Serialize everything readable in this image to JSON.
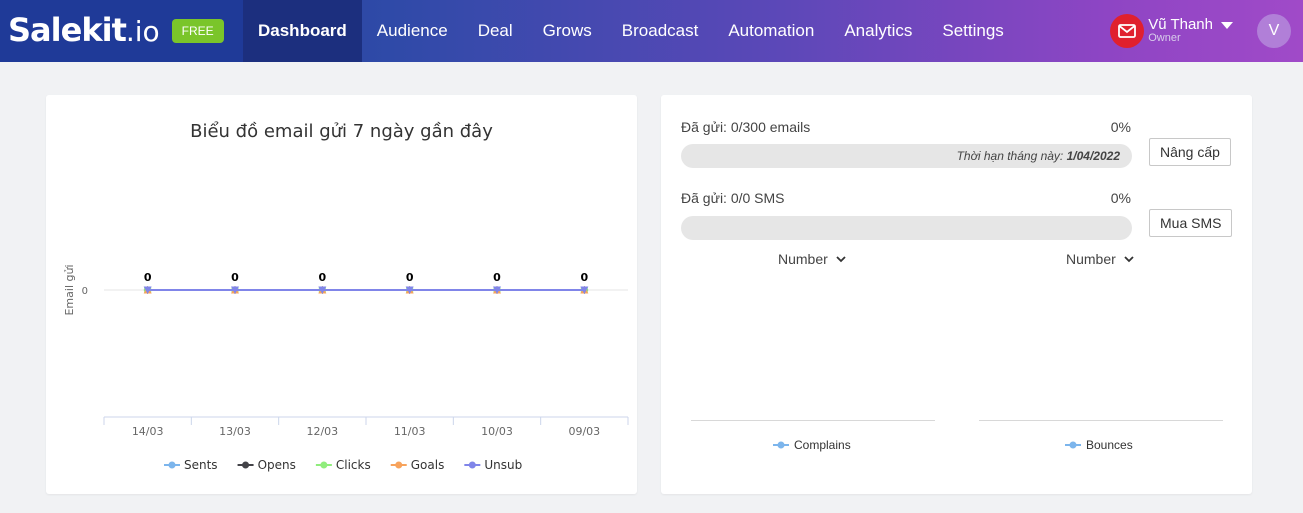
{
  "brand": {
    "logo_main": "Salekit",
    "logo_suffix": ".io",
    "plan_badge": "FREE"
  },
  "nav": {
    "items": [
      {
        "label": "Dashboard",
        "active": true
      },
      {
        "label": "Audience",
        "active": false
      },
      {
        "label": "Deal",
        "active": false
      },
      {
        "label": "Grows",
        "active": false
      },
      {
        "label": "Broadcast",
        "active": false
      },
      {
        "label": "Automation",
        "active": false
      },
      {
        "label": "Analytics",
        "active": false
      },
      {
        "label": "Settings",
        "active": false
      }
    ]
  },
  "user": {
    "name": "Vũ Thanh",
    "role": "Owner",
    "avatar_initial": "V"
  },
  "email_chart": {
    "title": "Biểu đồ email gửi 7 ngày gần đây",
    "chart_data": {
      "type": "line",
      "title": "Biểu đồ email gửi 7 ngày gần đây",
      "ylabel": "Email gửi",
      "xlabel": "",
      "categories": [
        "14/03",
        "13/03",
        "12/03",
        "11/03",
        "10/03",
        "09/03"
      ],
      "y_ticks": [
        "0"
      ],
      "ylim": [
        0,
        0
      ],
      "series": [
        {
          "name": "Sents",
          "color": "#7cb5ec",
          "values": [
            0,
            0,
            0,
            0,
            0,
            0
          ]
        },
        {
          "name": "Opens",
          "color": "#434348",
          "values": [
            0,
            0,
            0,
            0,
            0,
            0
          ]
        },
        {
          "name": "Clicks",
          "color": "#90ed7d",
          "values": [
            0,
            0,
            0,
            0,
            0,
            0
          ]
        },
        {
          "name": "Goals",
          "color": "#f7a35c",
          "values": [
            0,
            0,
            0,
            0,
            0,
            0
          ]
        },
        {
          "name": "Unsub",
          "color": "#8085e9",
          "values": [
            0,
            0,
            0,
            0,
            0,
            0
          ]
        }
      ],
      "data_labels": [
        "0",
        "0",
        "0",
        "0",
        "0",
        "0"
      ],
      "legend_position": "bottom",
      "grid": true
    }
  },
  "quota": {
    "email": {
      "label": "Đã gửi: 0/300 emails",
      "percent_text": "0%",
      "progress": 0,
      "note_prefix": "Thời hạn tháng này:",
      "note_date": "1/04/2022",
      "button": "Nâng cấp"
    },
    "sms": {
      "label": "Đã gửi: 0/0 SMS",
      "percent_text": "0%",
      "progress": 0,
      "button": "Mua SMS"
    }
  },
  "mini_charts": [
    {
      "selector": "Number",
      "legend": "Complains",
      "color": "#7cb5ec"
    },
    {
      "selector": "Number",
      "legend": "Bounces",
      "color": "#7cb5ec"
    }
  ]
}
